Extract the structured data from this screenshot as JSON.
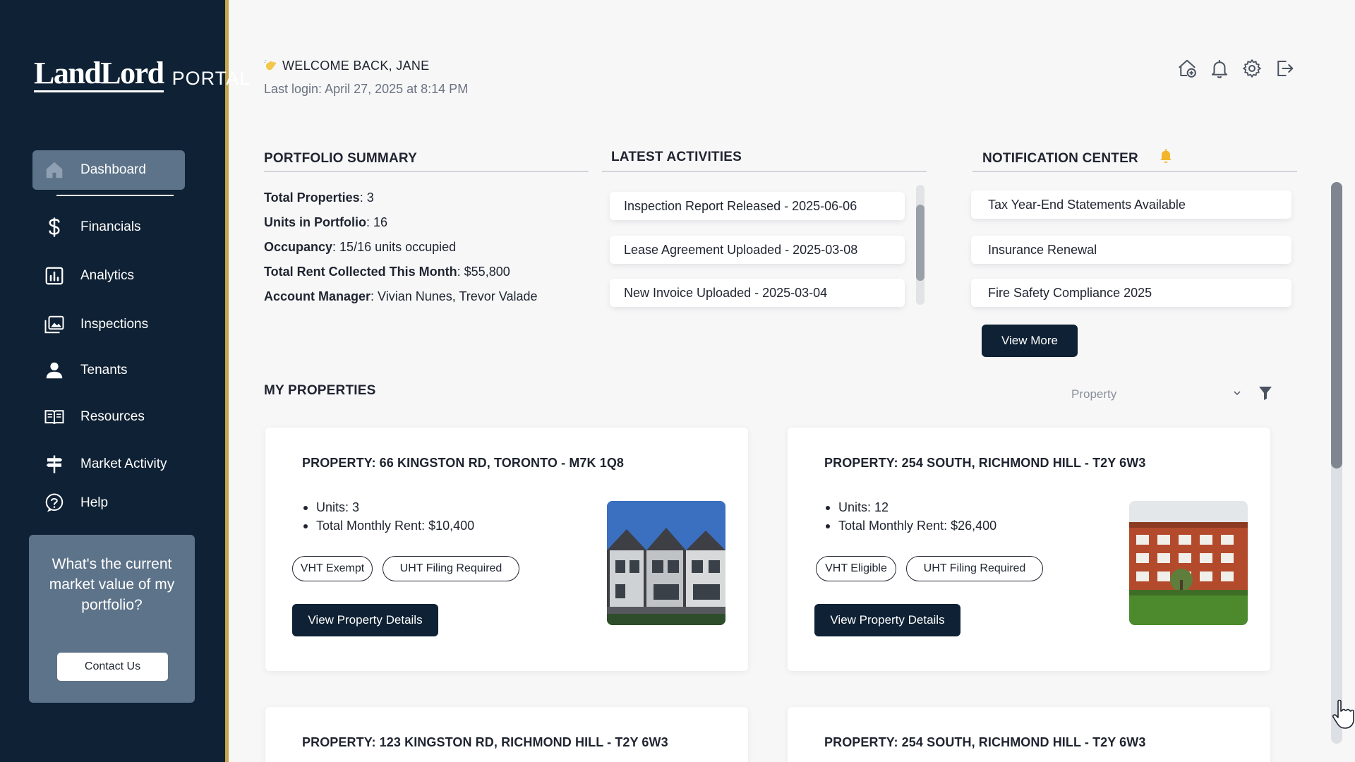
{
  "brand": {
    "logo_main": "LandLord",
    "logo_sub": "PORTAL"
  },
  "sidebar": {
    "items": [
      {
        "label": "Dashboard",
        "icon": "home-icon",
        "active": true
      },
      {
        "label": "Financials",
        "icon": "dollar-icon"
      },
      {
        "label": "Analytics",
        "icon": "bar-chart-icon"
      },
      {
        "label": "Inspections",
        "icon": "photo-gallery-icon"
      },
      {
        "label": "Tenants",
        "icon": "person-icon"
      },
      {
        "label": "Resources",
        "icon": "book-icon"
      },
      {
        "label": "Market Activity",
        "icon": "signpost-icon"
      },
      {
        "label": "Help",
        "icon": "help-icon"
      }
    ],
    "promo": {
      "text": "What's the current market value of my portfolio?",
      "button": "Contact Us"
    }
  },
  "header": {
    "welcome": "WELCOME BACK, JANE",
    "last_login": "Last login: April 27, 2025 at 8:14 PM",
    "icons": [
      "add-property-icon",
      "bell-icon",
      "gear-icon",
      "logout-icon"
    ]
  },
  "portfolio_summary": {
    "title": "PORTFOLIO SUMMARY",
    "rows": [
      {
        "label": "Total Properties",
        "value": ": 3"
      },
      {
        "label": "Units in Portfolio",
        "value": ": 16"
      },
      {
        "label": "Occupancy",
        "value": ": 15/16 units occupied"
      },
      {
        "label": "Total Rent Collected This Month",
        "value": ": $55,800"
      },
      {
        "label": "Account Manager",
        "value": ": Vivian Nunes, Trevor Valade"
      }
    ]
  },
  "latest_activities": {
    "title": "LATEST ACTIVITIES",
    "items": [
      "Inspection Report Released - 2025-06-06",
      "Lease Agreement Uploaded - 2025-03-08",
      "New Invoice Uploaded - 2025-03-04"
    ]
  },
  "notification_center": {
    "title": "NOTIFICATION CENTER",
    "items": [
      "Tax Year-End Statements Available",
      "Insurance Renewal",
      "Fire Safety Compliance 2025"
    ],
    "view_more": "View More"
  },
  "my_properties": {
    "title": "MY PROPERTIES",
    "filter_label": "Property",
    "view_details_label": "View Property Details",
    "cards": [
      {
        "title": "PROPERTY: 66 KINGSTON RD, TORONTO - M7K 1Q8",
        "units": "Units: 3",
        "rent": "Total Monthly Rent: $10,400",
        "tags": [
          "VHT Exempt",
          "UHT Filing Required"
        ]
      },
      {
        "title": "PROPERTY: 254 SOUTH, RICHMOND HILL - T2Y 6W3",
        "units": "Units: 12",
        "rent": "Total Monthly Rent: $26,400",
        "tags": [
          "VHT Eligible",
          "UHT Filing Required"
        ]
      },
      {
        "title": "PROPERTY: 123 KINGSTON RD, RICHMOND HILL - T2Y 6W3"
      },
      {
        "title": "PROPERTY: 254 SOUTH, RICHMOND HILL - T2Y 6W3"
      }
    ]
  },
  "colors": {
    "navy": "#0f2134",
    "slate": "#5d7389",
    "gold": "#c6a64a",
    "bell": "#f2b52b"
  }
}
